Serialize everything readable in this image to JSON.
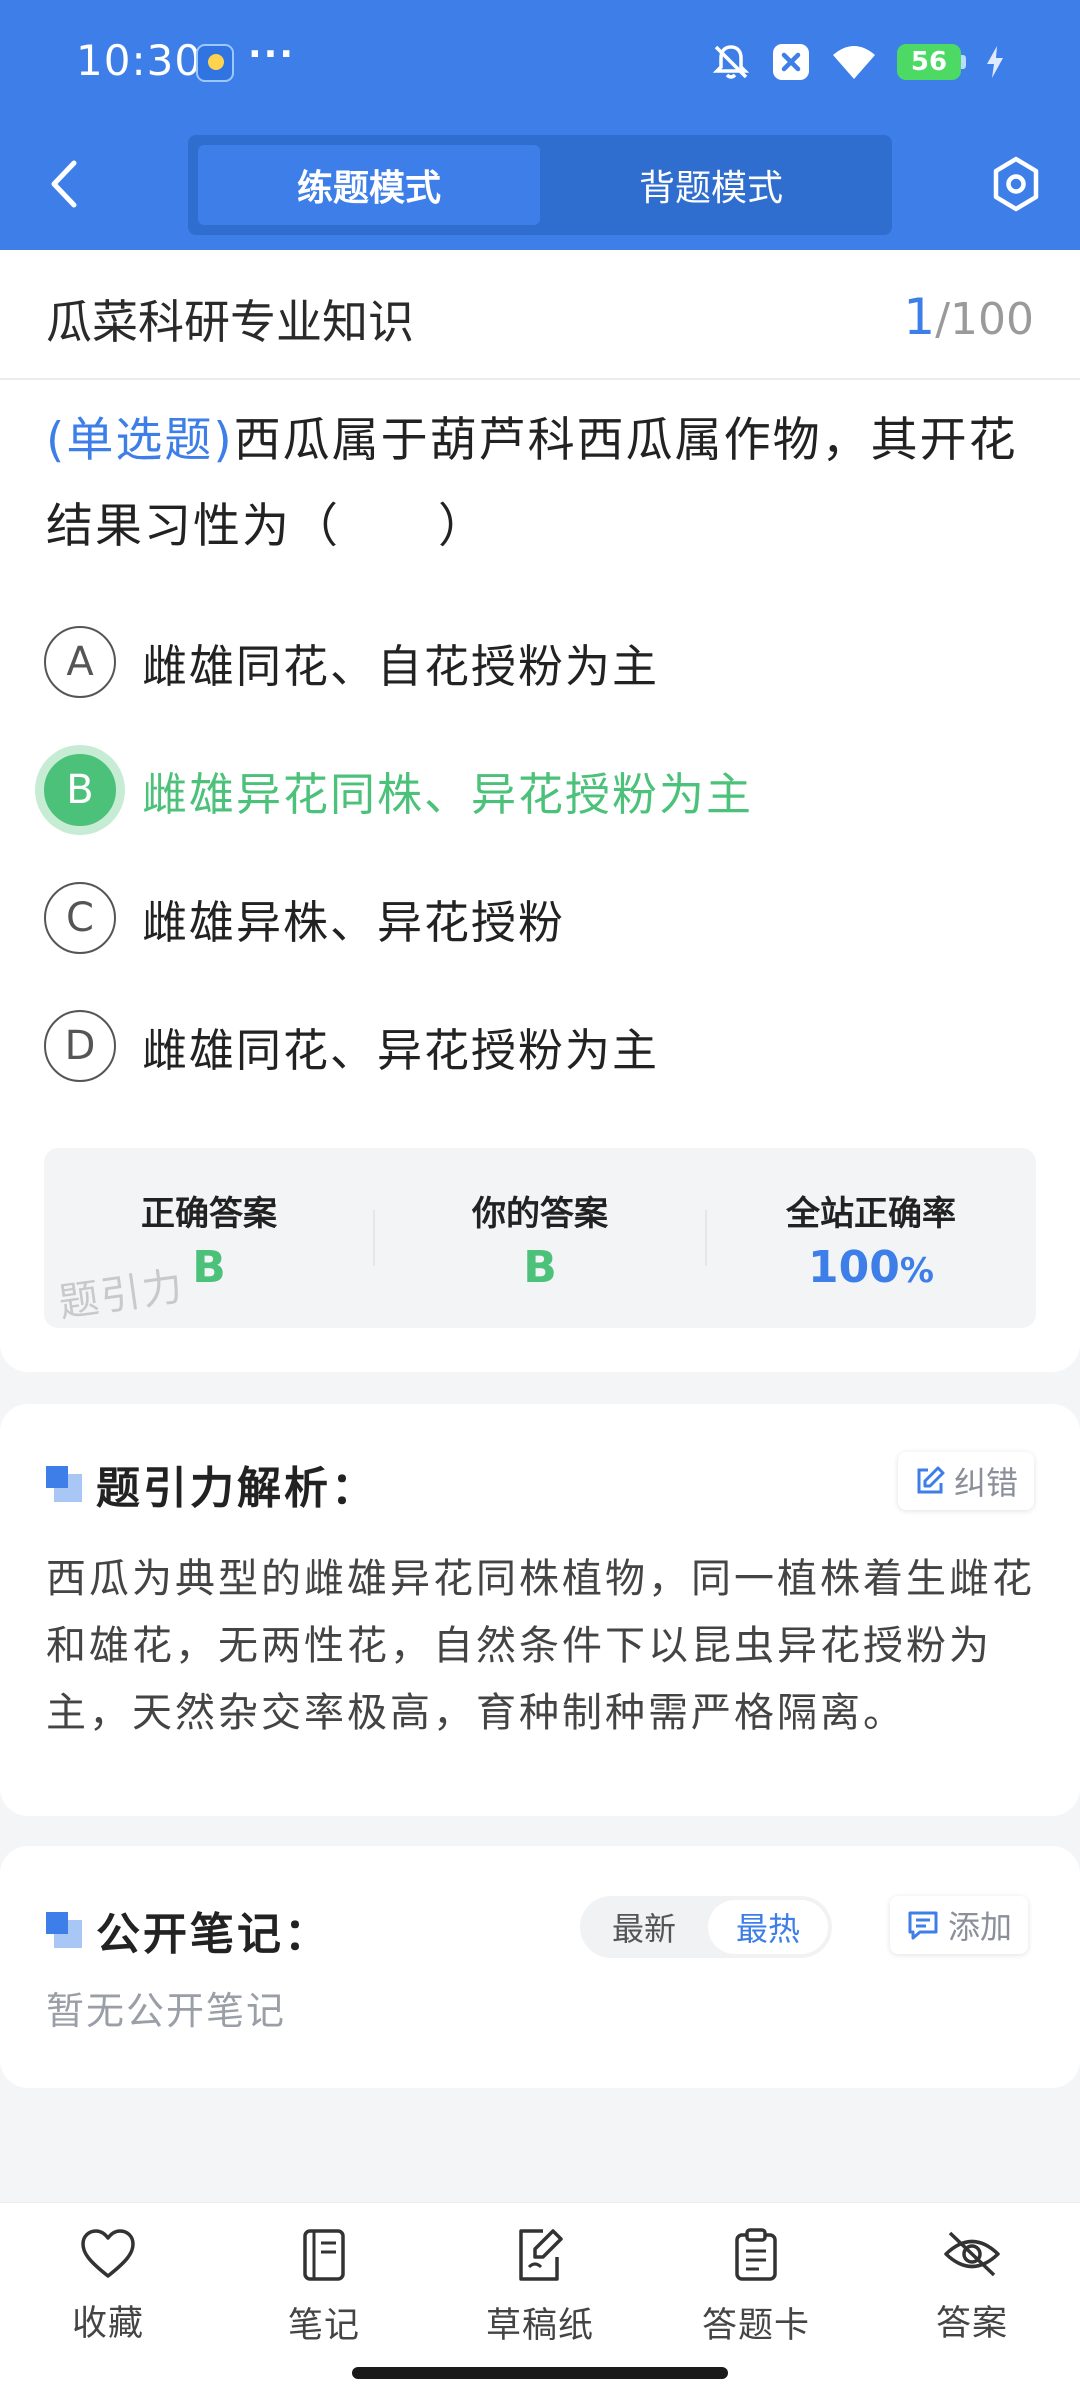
{
  "status_bar": {
    "time": "10:30",
    "dots": "···",
    "battery": "56",
    "icons": [
      "weather-app-icon",
      "mute-icon",
      "close-app-icon",
      "wifi-icon",
      "battery-icon",
      "charging-icon"
    ]
  },
  "header": {
    "modes": [
      "练题模式",
      "背题模式"
    ],
    "active_mode": "练题模式",
    "back_icon": "chevron-left-icon",
    "settings_icon": "hexagon-gear-icon"
  },
  "question_header": {
    "title": "瓜菜科研专业知识",
    "current": "1",
    "total": "/100"
  },
  "question": {
    "type": "(单选题)",
    "text": "西瓜属于葫芦科西瓜属作物，其开花结果习性为（　　）"
  },
  "options": [
    {
      "letter": "A",
      "text": "雌雄同花、自花授粉为主"
    },
    {
      "letter": "B",
      "text": "雌雄异花同株、异花授粉为主"
    },
    {
      "letter": "C",
      "text": "雌雄异株、异花授粉"
    },
    {
      "letter": "D",
      "text": "雌雄同花、异花授粉为主"
    }
  ],
  "selected_option": "B",
  "result": {
    "correct_label": "正确答案",
    "correct_value": "B",
    "yours_label": "你的答案",
    "yours_value": "B",
    "rate_label": "全站正确率",
    "rate_value": "100",
    "rate_unit": "%",
    "watermark": "题引力"
  },
  "analysis": {
    "title": "题引力解析：",
    "report_button": "纠错",
    "text": "西瓜为典型的雌雄异花同株植物，同一植株着生雌花和雄花，无两性花，自然条件下以昆虫异花授粉为主，天然杂交率极高，育种制种需严格隔离。"
  },
  "notes": {
    "title": "公开笔记：",
    "sort_options": [
      "最新",
      "最热"
    ],
    "active_sort": "最热",
    "add_button": "添加",
    "empty_text": "暂无公开笔记"
  },
  "bottom_bar": [
    {
      "label": "收藏",
      "icon": "heart-icon"
    },
    {
      "label": "笔记",
      "icon": "notebook-icon"
    },
    {
      "label": "草稿纸",
      "icon": "draft-paper-icon"
    },
    {
      "label": "答题卡",
      "icon": "answer-sheet-icon"
    },
    {
      "label": "答案",
      "icon": "eye-off-icon"
    }
  ],
  "colors": {
    "primary": "#3d7ee8",
    "correct": "#4cc17a",
    "background": "#f4f5f7"
  }
}
